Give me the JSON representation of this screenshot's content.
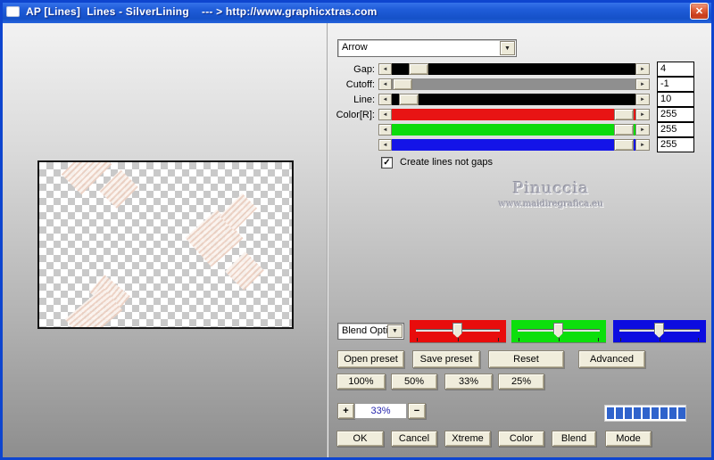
{
  "titlebar": {
    "title": "AP [Lines]  Lines - SilverLining    --- > http://www.graphicxtras.com"
  },
  "glyphs": {
    "close": "✕",
    "dropdown": "▼",
    "slider_left": "◄",
    "slider_right": "►",
    "check": "✓",
    "plus": "+",
    "minus": "−"
  },
  "shape_select": {
    "value": "Arrow"
  },
  "sliders": [
    {
      "label": "Gap:",
      "value": "4"
    },
    {
      "label": "Cutoff:",
      "value": "-1"
    },
    {
      "label": "Line:",
      "value": "10"
    },
    {
      "label": "Color[R]:",
      "value": "255"
    },
    {
      "label": "",
      "value": "255"
    },
    {
      "label": "",
      "value": "255"
    }
  ],
  "checkbox": {
    "label": "Create lines not gaps",
    "checked": true
  },
  "watermark": {
    "name": "Pinuccia",
    "site": "www.maidiregrafica.eu"
  },
  "blend": {
    "select_value": "Blend Opti"
  },
  "buttons": {
    "presets": [
      "Open preset",
      "Save preset",
      "Reset",
      "Advanced"
    ],
    "zoom_presets": [
      "100%",
      "50%",
      "33%",
      "25%"
    ],
    "actions": [
      "OK",
      "Cancel",
      "Xtreme",
      "Color",
      "Blend",
      "Mode"
    ]
  },
  "zoom_control": {
    "value": "33%"
  },
  "progress": {
    "segments": 9
  },
  "colors": {
    "titlebar_blue": "#1f5cd9",
    "window_border_blue": "#0e45cf",
    "close_red": "#d9552f",
    "track_black": "#000000",
    "track_gray": "#8f8f8f",
    "channel_red": "#e80c0c",
    "channel_green": "#0cdf0c",
    "channel_blue": "#0c0ce0",
    "progress_blue": "#2f63cc",
    "zoom_value_blue": "#2424ae",
    "button_face": "#f0eddc"
  }
}
